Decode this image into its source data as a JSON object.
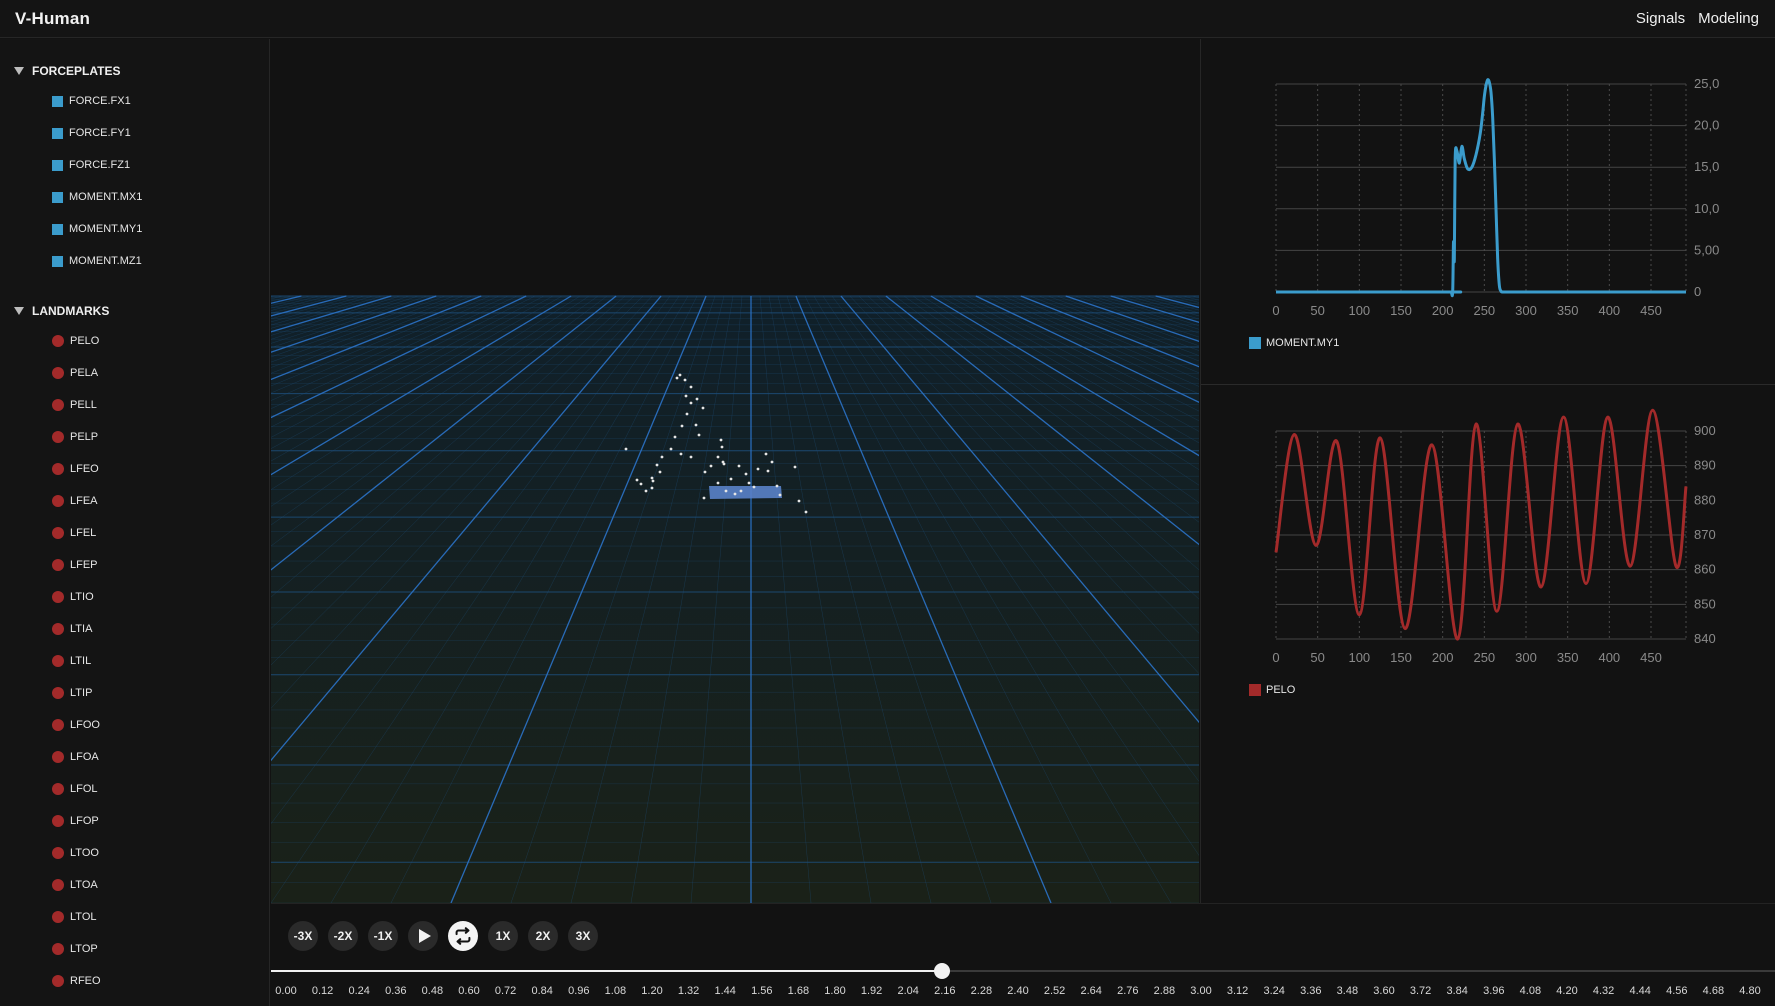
{
  "app": {
    "title": "V-Human"
  },
  "nav": {
    "items": [
      "Signals",
      "Modeling"
    ]
  },
  "sidebar": {
    "forceplates": {
      "label": "FORCEPLATES",
      "items": [
        "FORCE.FX1",
        "FORCE.FY1",
        "FORCE.FZ1",
        "MOMENT.MX1",
        "MOMENT.MY1",
        "MOMENT.MZ1"
      ]
    },
    "landmarks": {
      "label": "LANDMARKS",
      "items": [
        "PELO",
        "PELA",
        "PELL",
        "PELP",
        "LFEO",
        "LFEA",
        "LFEL",
        "LFEP",
        "LTIO",
        "LTIA",
        "LTIL",
        "LTIP",
        "LFOO",
        "LFOA",
        "LFOL",
        "LFOP",
        "LTOO",
        "LTOA",
        "LTOL",
        "LTOP",
        "RFEO"
      ]
    }
  },
  "colors": {
    "forceplate": "#3b9ccc",
    "landmark": "#a32a2a",
    "grid": "#1e5a9a",
    "accent": "#f2f2f2"
  },
  "chart_data": [
    {
      "type": "line",
      "title": "",
      "xlabel": "",
      "ylabel": "",
      "x_ticks": [
        "0",
        "50",
        "100",
        "150",
        "200",
        "250",
        "300",
        "350",
        "400",
        "450"
      ],
      "y_ticks": [
        "0",
        "5,00",
        "10,0",
        "15,0",
        "20,0",
        "25,0"
      ],
      "xlim": [
        0,
        492
      ],
      "ylim": [
        0,
        25000
      ],
      "grid": true,
      "legend_position": "bottom-left",
      "series": [
        {
          "name": "MOMENT.MY1",
          "color": "#3b9ccc",
          "x": [
            0,
            205,
            210,
            212,
            213,
            214,
            215,
            217,
            220,
            223,
            226,
            230,
            235,
            240,
            245,
            248,
            250,
            252,
            254,
            256,
            258,
            260,
            262,
            264,
            266,
            268,
            270,
            272,
            275,
            280,
            300,
            350,
            400,
            450,
            492
          ],
          "y": [
            0,
            0,
            0,
            0,
            6000,
            4000,
            16000,
            17000,
            15500,
            17500,
            16000,
            14800,
            15000,
            16500,
            19000,
            21500,
            23500,
            24800,
            25500,
            25200,
            24000,
            21000,
            16000,
            10000,
            4000,
            800,
            100,
            0,
            0,
            0,
            0,
            0,
            0,
            0,
            0
          ]
        }
      ]
    },
    {
      "type": "line",
      "title": "",
      "xlabel": "",
      "ylabel": "",
      "x_ticks": [
        "0",
        "50",
        "100",
        "150",
        "200",
        "250",
        "300",
        "350",
        "400",
        "450"
      ],
      "y_ticks": [
        "840",
        "850",
        "860",
        "870",
        "880",
        "890",
        "900"
      ],
      "xlim": [
        0,
        492
      ],
      "ylim": [
        840,
        900
      ],
      "grid": true,
      "legend_position": "bottom-left",
      "series": [
        {
          "name": "PELO",
          "color": "#a32a2a",
          "x": [
            0,
            22,
            48,
            73,
            100,
            125,
            155,
            187,
            218,
            240,
            265,
            290,
            318,
            345,
            372,
            398,
            425,
            452,
            480,
            492
          ],
          "y": [
            865,
            899,
            867,
            897,
            847,
            898,
            843,
            896,
            840,
            902,
            848,
            902,
            855,
            904,
            856,
            904,
            861,
            906,
            861,
            884
          ]
        }
      ]
    }
  ],
  "playback": {
    "buttons": [
      "-3X",
      "-2X",
      "-1X",
      "1X",
      "2X",
      "3X"
    ],
    "progress": 0.446,
    "ticks": [
      "0.00",
      "0.12",
      "0.24",
      "0.36",
      "0.48",
      "0.60",
      "0.72",
      "0.84",
      "0.96",
      "1.08",
      "1.20",
      "1.32",
      "1.44",
      "1.56",
      "1.68",
      "1.80",
      "1.92",
      "2.04",
      "2.16",
      "2.28",
      "2.40",
      "2.52",
      "2.64",
      "2.76",
      "2.88",
      "3.00",
      "3.12",
      "3.24",
      "3.36",
      "3.48",
      "3.60",
      "3.72",
      "3.84",
      "3.96",
      "4.08",
      "4.20",
      "4.32",
      "4.44",
      "4.56",
      "4.68",
      "4.80"
    ]
  }
}
